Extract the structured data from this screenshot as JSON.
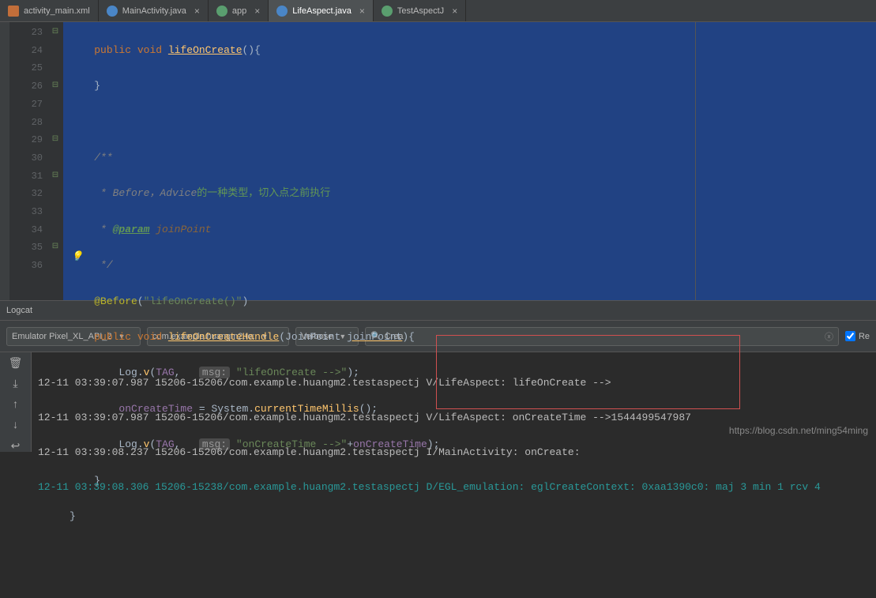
{
  "tabs": [
    {
      "label": "activity_main.xml",
      "iconClass": "icon-xml",
      "active": false
    },
    {
      "label": "MainActivity.java",
      "iconClass": "icon-java",
      "active": false,
      "closeable": true
    },
    {
      "label": "app",
      "iconClass": "icon-app",
      "active": false,
      "closeable": true
    },
    {
      "label": "LifeAspect.java",
      "iconClass": "icon-java",
      "active": true,
      "closeable": true
    },
    {
      "label": "TestAspectJ",
      "iconClass": "icon-app",
      "active": false,
      "closeable": true
    }
  ],
  "code": {
    "line23": {
      "kw1": "public",
      "kw2": "void",
      "method": "lifeOnCreate",
      "rest": "(){"
    },
    "line24": "}",
    "line26": "/**",
    "line27": {
      "prefix": " * ",
      "en": "Before，Advice",
      "cn": "的一种类型，切入点之前执行"
    },
    "line28": {
      "prefix": " * ",
      "tag": "@param",
      "name": " joinPoint"
    },
    "line29": " */",
    "line30": {
      "anno": "@Before",
      "paren_l": "(",
      "str": "\"lifeOnCreate()\"",
      "paren_r": ")"
    },
    "line31": {
      "kw1": "public",
      "kw2": "void",
      "method": "lifeOnCreateHandle",
      "paren_l": "(",
      "type": "JoinPoint ",
      "param": "joinPoint",
      "paren_r": "){"
    },
    "line32": {
      "logv": "Log.",
      "v": "v",
      "paren_l": "(",
      "tag": "TAG",
      "comma": ", ",
      "hint": "msg:",
      "space": " ",
      "str": "\"lifeOnCreate -->\"",
      "paren_r": ");"
    },
    "line33": {
      "field": "onCreateTime",
      "eq": " = System.",
      "method": "currentTimeMillis",
      "rest": "();"
    },
    "line34": {
      "logv": "Log.",
      "v": "v",
      "paren_l": "(",
      "tag": "TAG",
      "comma": ", ",
      "hint": "msg:",
      "space": " ",
      "str": "\"onCreateTime -->\"",
      "plus": "+",
      "field": "onCreateTime",
      "paren_r": ");"
    },
    "line35": "}",
    "line36": "}"
  },
  "gutter": [
    "23",
    "24",
    "25",
    "26",
    "27",
    "28",
    "29",
    "30",
    "31",
    "32",
    "33",
    "34",
    "35",
    "36"
  ],
  "logcat": {
    "title": "Logcat",
    "device": "Emulator Pixel_XL_API_2",
    "package": "com.example.huangm2.te:",
    "level": "Verbose",
    "search": "Crea",
    "regex_label": "Re",
    "lines": [
      "12-11 03:39:07.987 15206-15206/com.example.huangm2.testaspectj V/LifeAspect: lifeOnCreate -->",
      "12-11 03:39:07.987 15206-15206/com.example.huangm2.testaspectj V/LifeAspect: onCreateTime -->1544499547987",
      "12-11 03:39:08.237 15206-15206/com.example.huangm2.testaspectj I/MainActivity: onCreate:",
      "12-11 03:39:08.306 15206-15238/com.example.huangm2.testaspectj D/EGL_emulation: eglCreateContext: 0xaa1390c0: maj 3 min 1 rcv 4"
    ]
  },
  "watermark": "https://blog.csdn.net/ming54ming"
}
